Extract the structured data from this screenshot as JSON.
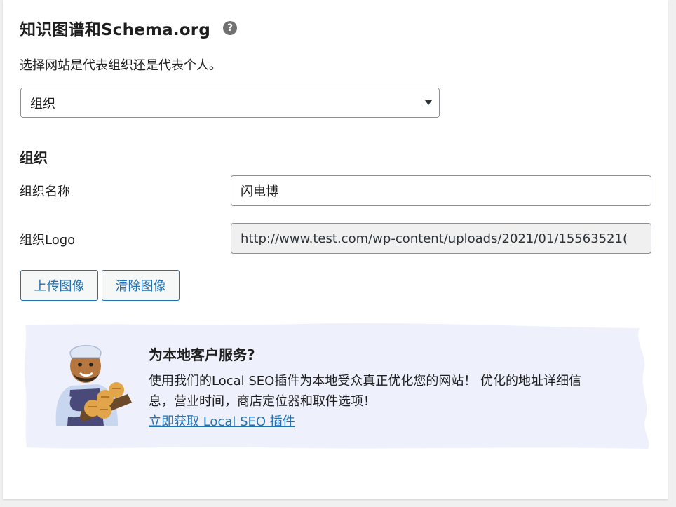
{
  "header": {
    "title": "知识图谱和Schema.org",
    "help_icon": "question-mark-icon"
  },
  "description": "选择网站是代表组织还是代表个人。",
  "type_select": {
    "selected": "组织"
  },
  "organization": {
    "heading": "组织",
    "name_label": "组织名称",
    "name_value": "闪电博",
    "logo_label": "组织Logo",
    "logo_value": "http://www.test.com/wp-content/uploads/2021/01/15563521(",
    "upload_button": "上传图像",
    "clear_button": "清除图像"
  },
  "promo": {
    "title": "为本地客户服务?",
    "text_line1": "使用我们的Local SEO插件为本地受众真正优化您的网站！ 优化的地址详细信",
    "text_line2": "息，营业时间，商店定位器和取件选项！",
    "link": "立即获取 Local SEO 插件",
    "bg_color": "#eef0fc",
    "icon": "chef-with-bread-illustration"
  },
  "colors": {
    "accent": "#2271b1",
    "border": "#8c8f94",
    "readonly_bg": "#f0f0f1"
  }
}
